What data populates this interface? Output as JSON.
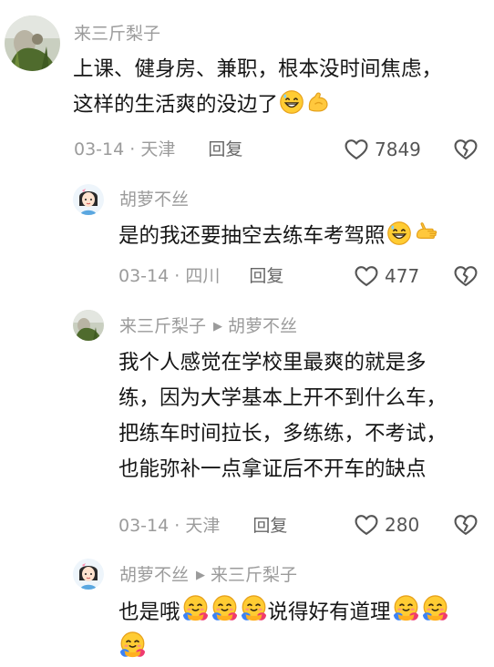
{
  "comments": [
    {
      "author": "来三斤梨子",
      "reply_to": "",
      "lines": [
        "上课、健身房、兼职，根本没时间焦虑，",
        "这样的生活爽的没边了"
      ],
      "date": "03-14",
      "location": "天津",
      "reply_label": "回复",
      "likes": "7849"
    },
    {
      "author": "胡萝不丝",
      "reply_to": "",
      "lines": [
        "是的我还要抽空去练车考驾照"
      ],
      "date": "03-14",
      "location": "四川",
      "reply_label": "回复",
      "likes": "477"
    },
    {
      "author": "来三斤梨子",
      "reply_to": "胡萝不丝",
      "lines": [
        "我个人感觉在学校里最爽的就是多",
        "练，因为大学基本上开不到什么车，",
        "把练车时间拉长，多练练，不考试，",
        "也能弥补一点拿证后不开车的缺点"
      ],
      "date": "03-14",
      "location": "天津",
      "reply_label": "回复",
      "likes": "280"
    },
    {
      "author": "胡萝不丝",
      "reply_to": "来三斤梨子",
      "lines": [
        "也是哦",
        "说得好有道理"
      ],
      "date": "",
      "location": "",
      "reply_label": "",
      "likes": ""
    }
  ],
  "icons": {
    "like": "heart-outline-icon",
    "dislike": "broken-heart-icon",
    "reply_arrow": "triangle-right-icon"
  },
  "colors": {
    "text": "#161616",
    "muted": "#9b9b9b",
    "background": "#ffffff"
  }
}
